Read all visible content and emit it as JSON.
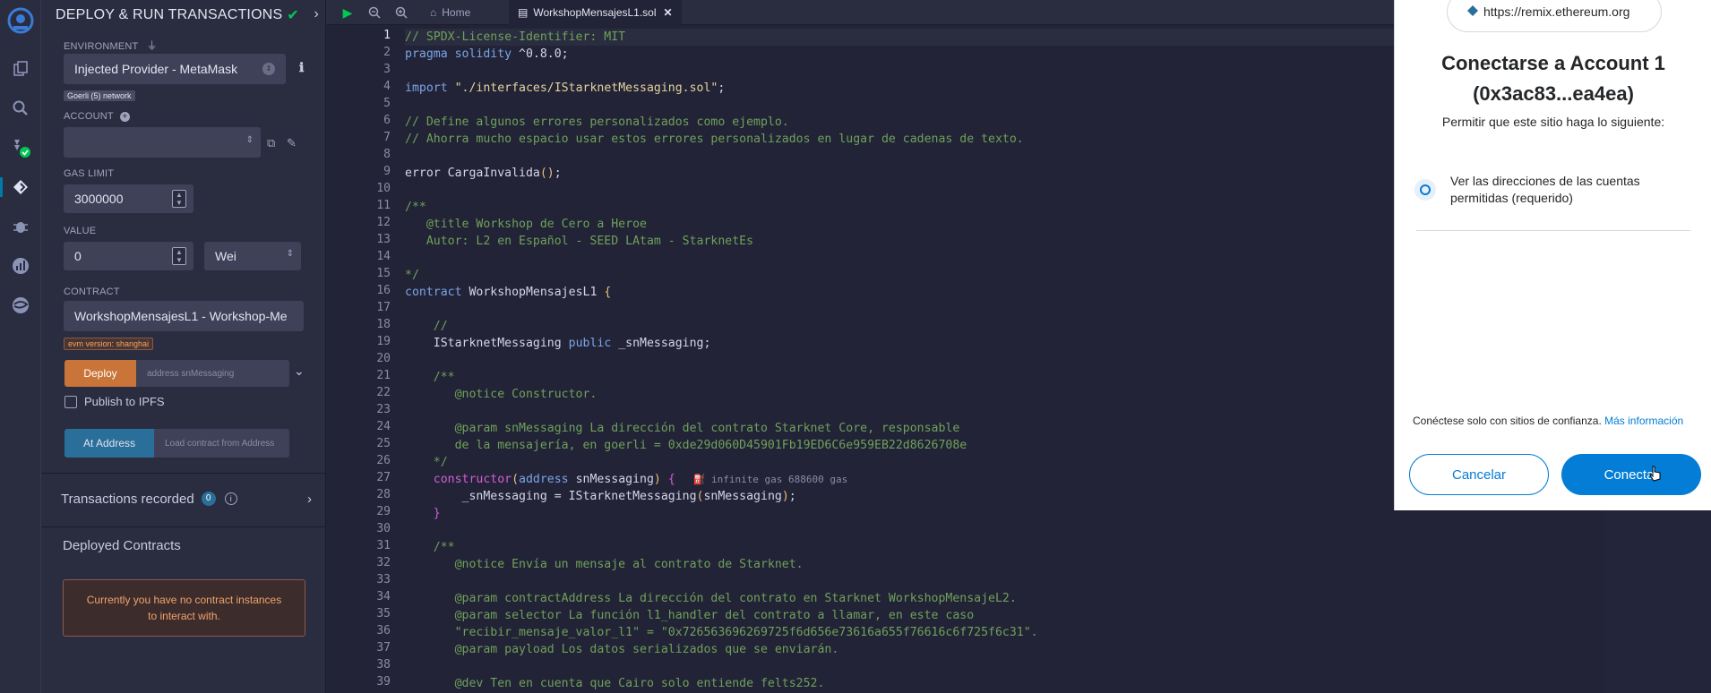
{
  "panel": {
    "title": "DEPLOY & RUN TRANSACTIONS",
    "environment_label": "ENVIRONMENT",
    "environment_value": "Injected Provider - MetaMask",
    "network_badge": "Goerli (5) network",
    "account_label": "ACCOUNT",
    "account_value": "",
    "gas_limit_label": "GAS LIMIT",
    "gas_limit_value": "3000000",
    "value_label": "VALUE",
    "value_amount": "0",
    "value_unit": "Wei",
    "contract_label": "CONTRACT",
    "contract_value": "WorkshopMensajesL1 - Workshop-Me",
    "evm_badge": "evm version: shanghai",
    "deploy_label": "Deploy",
    "deploy_placeholder": "address snMessaging",
    "publish_ipfs_label": "Publish to IPFS",
    "at_address_label": "At Address",
    "at_address_placeholder": "Load contract from Address",
    "transactions_recorded_label": "Transactions recorded",
    "transactions_count": "0",
    "deployed_contracts_label": "Deployed Contracts",
    "no_instances_text": "Currently you have no contract instances to interact with."
  },
  "toolbar": {
    "home_tab": "Home",
    "file_tab": "WorkshopMensajesL1.sol"
  },
  "editor": {
    "line_numbers": [
      "1",
      "2",
      "3",
      "4",
      "5",
      "6",
      "7",
      "8",
      "9",
      "10",
      "11",
      "12",
      "13",
      "14",
      "15",
      "16",
      "17",
      "18",
      "19",
      "20",
      "21",
      "22",
      "23",
      "24",
      "25",
      "26",
      "27",
      "28",
      "29",
      "30",
      "31",
      "32",
      "33",
      "34",
      "35",
      "36",
      "37",
      "38",
      "39"
    ],
    "gas_hint": "infinite gas 688600 gas"
  },
  "modal": {
    "site_url": "https://remix.ethereum.org",
    "title_line1": "Conectarse a Account 1",
    "title_line2": "(0x3ac83...ea4ea)",
    "subtitle": "Permitir que este sitio haga lo siguiente:",
    "permission_text": "Ver las direcciones de las cuentas permitidas (requerido)",
    "trust_text": "Conéctese solo con sitios de confianza.",
    "more_info_link": "Más información",
    "cancel_label": "Cancelar",
    "connect_label": "Conectar"
  },
  "colors": {
    "accent": "#037dd6",
    "deploy_orange": "#c97539",
    "success": "#00c853"
  }
}
